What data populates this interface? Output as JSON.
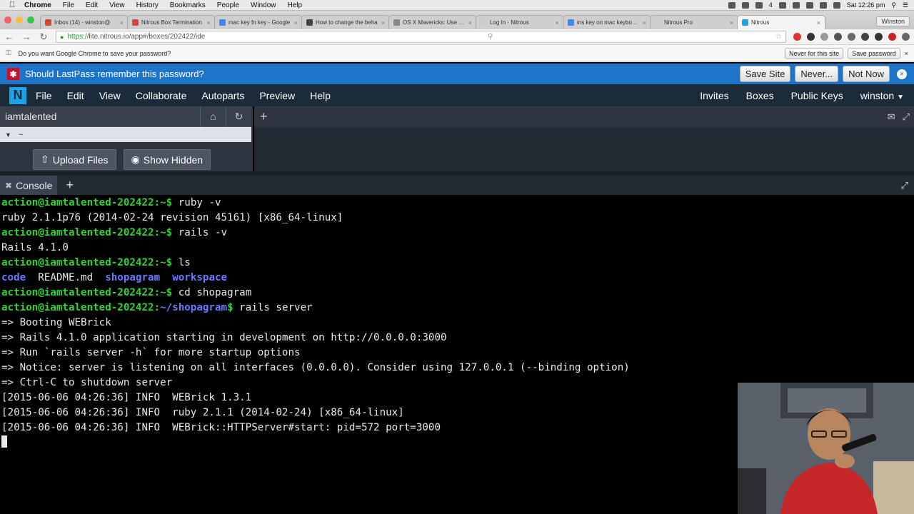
{
  "menubar": {
    "app": "Chrome",
    "items": [
      "File",
      "Edit",
      "View",
      "History",
      "Bookmarks",
      "People",
      "Window",
      "Help"
    ],
    "clock": "Sat 12:26 pm",
    "battery_level": "4"
  },
  "tabs": [
    {
      "title": "Inbox (14) - winston@",
      "favicon_color": "#d44638"
    },
    {
      "title": "Nitrous Box Termination",
      "favicon_color": "#d44638"
    },
    {
      "title": "mac key fn key - Google",
      "favicon_color": "#4285f4"
    },
    {
      "title": "How to change the beha",
      "favicon_color": "#444444"
    },
    {
      "title": "OS X Mavericks: Use keyb",
      "favicon_color": "#888888"
    },
    {
      "title": "Log In · Nitrous",
      "favicon_color": "#cccccc"
    },
    {
      "title": "ins key on mac keyboard",
      "favicon_color": "#4285f4"
    },
    {
      "title": "Nitrous Pro",
      "favicon_color": "#cccccc"
    },
    {
      "title": "Nitrous",
      "favicon_color": "#1aa3e8",
      "active": true
    }
  ],
  "profile": "Winston",
  "address": {
    "scheme": "https://",
    "rest": "lite.nitrous.io/app#/boxes/202422/ide"
  },
  "savebar": {
    "question": "Do you want Google Chrome to save your password?",
    "never_label": "Never for this site",
    "save_label": "Save password"
  },
  "lastpass": {
    "message": "Should LastPass remember this password?",
    "save_site": "Save Site",
    "never": "Never...",
    "not_now": "Not Now"
  },
  "appnav": {
    "logo": "N",
    "items": [
      "File",
      "Edit",
      "View",
      "Collaborate",
      "Autoparts",
      "Preview",
      "Help"
    ],
    "right": [
      "Invites",
      "Boxes",
      "Public Keys",
      "winston"
    ]
  },
  "tree": {
    "title": "iamtalented",
    "root": "~",
    "upload_label": "Upload Files",
    "show_hidden_label": "Show Hidden"
  },
  "console": {
    "tab_label": "Console"
  },
  "terminal": {
    "prompt_user": "action@iamtalented-202422",
    "lines": [
      {
        "type": "prompt",
        "path": "~",
        "cmd": "ruby -v"
      },
      {
        "type": "out",
        "text": "ruby 2.1.1p76 (2014-02-24 revision 45161) [x86_64-linux]"
      },
      {
        "type": "prompt",
        "path": "~",
        "cmd": "rails -v"
      },
      {
        "type": "out",
        "text": "Rails 4.1.0"
      },
      {
        "type": "prompt",
        "path": "~",
        "cmd": "ls"
      },
      {
        "type": "ls",
        "items": [
          {
            "name": "code",
            "dir": true
          },
          {
            "name": "README.md",
            "dir": false
          },
          {
            "name": "shopagram",
            "dir": true
          },
          {
            "name": "workspace",
            "dir": true
          }
        ]
      },
      {
        "type": "prompt",
        "path": "~",
        "cmd": "cd shopagram"
      },
      {
        "type": "prompt",
        "path": "~/shopagram",
        "cmd": "rails server"
      },
      {
        "type": "out",
        "text": "=> Booting WEBrick"
      },
      {
        "type": "out",
        "text": "=> Rails 4.1.0 application starting in development on http://0.0.0.0:3000"
      },
      {
        "type": "out",
        "text": "=> Run `rails server -h` for more startup options"
      },
      {
        "type": "out",
        "text": "=> Notice: server is listening on all interfaces (0.0.0.0). Consider using 127.0.0.1 (--binding option)"
      },
      {
        "type": "out",
        "text": "=> Ctrl-C to shutdown server"
      },
      {
        "type": "out",
        "text": "[2015-06-06 04:26:36] INFO  WEBrick 1.3.1"
      },
      {
        "type": "out",
        "text": "[2015-06-06 04:26:36] INFO  ruby 2.1.1 (2014-02-24) [x86_64-linux]"
      },
      {
        "type": "out",
        "text": "[2015-06-06 04:26:36] INFO  WEBrick::HTTPServer#start: pid=572 port=3000"
      },
      {
        "type": "cursor"
      }
    ]
  },
  "colors": {
    "prompt_green": "#2fd42f",
    "path_blue": "#6a78ff",
    "lastpass_blue": "#1e74c9",
    "nav_dark": "#1b2b3a",
    "nitrous_accent": "#1aa3e8"
  }
}
